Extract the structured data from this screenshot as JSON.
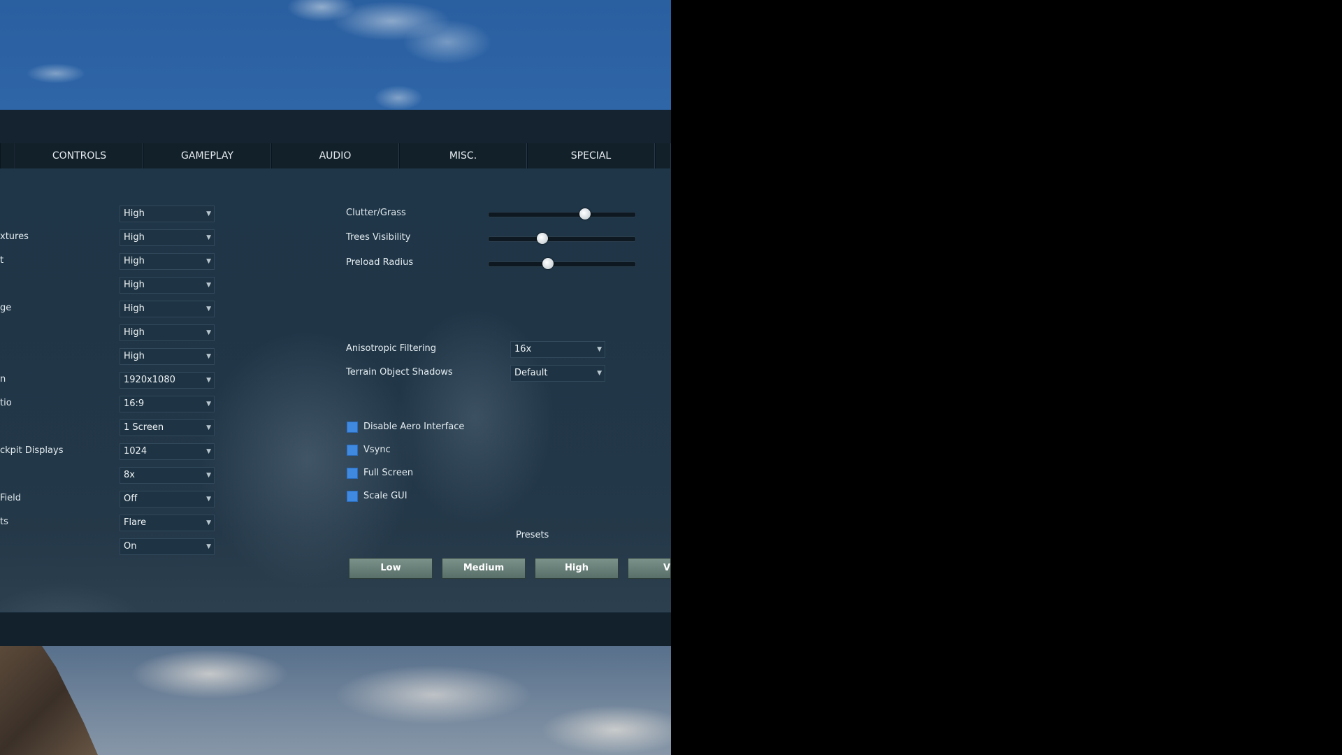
{
  "tabs": [
    "CONTROLS",
    "GAMEPLAY",
    "AUDIO",
    "MISC.",
    "SPECIAL"
  ],
  "left_rows": [
    {
      "label": "",
      "value": "High"
    },
    {
      "label": "xtures",
      "value": "High"
    },
    {
      "label": "t",
      "value": "High"
    },
    {
      "label": "",
      "value": "High"
    },
    {
      "label": "ge",
      "value": "High"
    },
    {
      "label": "",
      "value": "High"
    },
    {
      "label": "",
      "value": "High"
    },
    {
      "label": "n",
      "value": "1920x1080"
    },
    {
      "label": "tio",
      "value": "16:9"
    },
    {
      "label": "",
      "value": "1 Screen"
    },
    {
      "label": "ckpit Displays",
      "value": "1024"
    },
    {
      "label": "",
      "value": "8x"
    },
    {
      "label": "Field",
      "value": "Off"
    },
    {
      "label": "ts",
      "value": "Flare"
    },
    {
      "label": "",
      "value": "On"
    }
  ],
  "sliders": [
    {
      "label": "Clutter/Grass",
      "value": 0.66
    },
    {
      "label": "Trees Visibility",
      "value": 0.37
    },
    {
      "label": "Preload Radius",
      "value": 0.41
    }
  ],
  "right_dropdowns": [
    {
      "label": "Anisotropic Filtering",
      "value": "16x"
    },
    {
      "label": "Terrain Object Shadows",
      "value": "Default"
    }
  ],
  "checkboxes": [
    {
      "label": "Disable Aero Interface",
      "checked": false
    },
    {
      "label": "Vsync",
      "checked": false
    },
    {
      "label": "Full Screen",
      "checked": false
    },
    {
      "label": "Scale GUI",
      "checked": false
    }
  ],
  "presets": {
    "title": "Presets",
    "buttons": [
      "Low",
      "Medium",
      "High",
      "V"
    ]
  },
  "icons": {
    "dropdown_caret": "chevron-down-icon",
    "slider_knob": "slider-knob-icon"
  },
  "colors": {
    "panel": "#1d3344",
    "checkbox": "#3f89e0",
    "preset_button": "#6b827b"
  }
}
